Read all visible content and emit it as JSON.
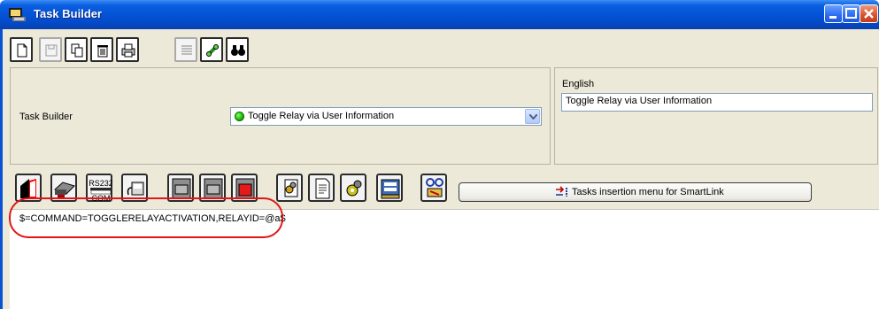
{
  "window": {
    "title": "Task Builder",
    "title_bar_color": "#0453d6"
  },
  "toolbar_top": {
    "buttons": [
      {
        "name": "new-icon",
        "enabled": true
      },
      {
        "name": "save-icon",
        "enabled": false
      },
      {
        "name": "copy-icon",
        "enabled": true
      },
      {
        "name": "delete-icon",
        "enabled": true
      },
      {
        "name": "print-icon",
        "enabled": true
      },
      {
        "name": "list-icon",
        "enabled": false
      },
      {
        "name": "link-icon",
        "enabled": true
      },
      {
        "name": "find-icon",
        "enabled": true
      }
    ]
  },
  "task_panel": {
    "label": "Task Builder",
    "selected_task": "Toggle Relay via User Information",
    "status_color": "#10a800"
  },
  "language_panel": {
    "language": "English",
    "description_value": "Toggle Relay via User Information"
  },
  "toolbar_insert": {
    "icons": [
      "door-icon",
      "network-device-icon",
      "rs232-com-icon",
      "terminal-icon",
      "cabinet-gray-icon",
      "cabinet-gray-icon",
      "cabinet-red-icon",
      "script-gears-icon",
      "document-icon",
      "gears-icon",
      "form-icon",
      "link-settings-icon"
    ],
    "rs232_label": "RS232",
    "com_label": "COM",
    "menu_button_label": "Tasks insertion menu for SmartLink"
  },
  "editor": {
    "code": "$=COMMAND=TOGGLERELAYACTIVATION,RELAYID=@a$",
    "highlight_color": "#e11616"
  }
}
